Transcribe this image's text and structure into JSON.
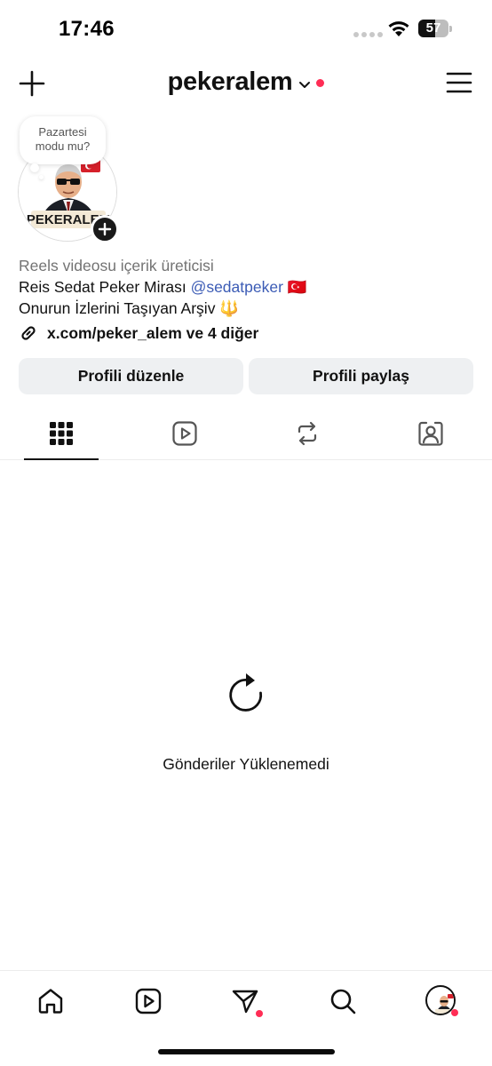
{
  "status_bar": {
    "time": "17:46",
    "battery_percent": 57,
    "battery_label": "57"
  },
  "header": {
    "username": "pekeralem",
    "has_notification_dot": true
  },
  "profile": {
    "note": "Pazartesi modu mu?",
    "avatar_caption": "PEKERALEM",
    "bio_category": "Reels videosu içerik üreticisi",
    "bio_line1_text": "Reis Sedat Peker Mirası",
    "bio_line1_mention": "@sedatpeker",
    "bio_line1_emoji": "🇹🇷",
    "bio_line2_text": "Onurun İzlerini Taşıyan Arşiv",
    "bio_line2_emoji": "🔱",
    "link": "x.com/peker_alem ve 4 diğer"
  },
  "actions": {
    "edit_profile": "Profili düzenle",
    "share_profile": "Profili paylaş"
  },
  "tabs": [
    {
      "icon": "grid-icon",
      "active": true
    },
    {
      "icon": "reels-icon",
      "active": false
    },
    {
      "icon": "reposts-icon",
      "active": false
    },
    {
      "icon": "tagged-icon",
      "active": false
    }
  ],
  "content": {
    "error_message": "Gönderiler Yüklenemedi"
  },
  "bottom_nav": [
    {
      "icon": "home-icon"
    },
    {
      "icon": "reels-icon"
    },
    {
      "icon": "direct-message-icon",
      "has_dot": true
    },
    {
      "icon": "search-icon"
    },
    {
      "icon": "profile-avatar",
      "has_dot": true
    }
  ],
  "colors": {
    "accent_red": "#ff2d55",
    "mention_blue": "#3b5bb5",
    "button_bg": "#eef0f2",
    "muted_text": "#737373"
  }
}
